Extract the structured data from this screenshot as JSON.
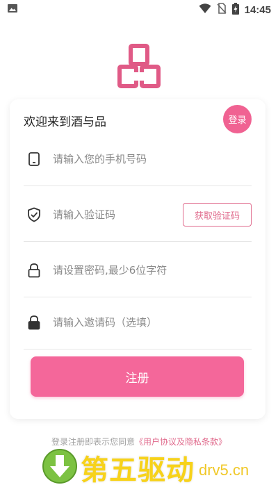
{
  "status_bar": {
    "time": "14:45",
    "icons": [
      "image-icon",
      "wifi-icon",
      "no-sim-icon",
      "battery-charging-icon"
    ]
  },
  "logo": {
    "icon": "brand-logo-icon",
    "color": "#e05a86"
  },
  "card": {
    "welcome_text": "欢迎来到酒与品",
    "login_label": "登录",
    "phone": {
      "placeholder": "请输入您的手机号码",
      "icon": "phone-icon"
    },
    "code": {
      "placeholder": "请输入验证码",
      "icon": "shield-check-icon",
      "button_label": "获取验证码"
    },
    "password": {
      "placeholder": "请设置密码,最少6位字符",
      "icon": "lock-icon"
    },
    "invite": {
      "placeholder": "请输入邀请码（选填）",
      "icon": "lock-icon"
    },
    "register_label": "注册"
  },
  "agreement": {
    "prefix": "登录注册即表示您同意",
    "link": "《用户协议及隐私条款》"
  },
  "watermark": {
    "text": "第五驱动",
    "domain": "drv5.cn",
    "icon": "download-arrow-icon"
  },
  "colors": {
    "accent": "#f4679a",
    "link": "#e06a8c",
    "watermark_yellow": "#f7d21a",
    "watermark_green": "#7cc242"
  }
}
